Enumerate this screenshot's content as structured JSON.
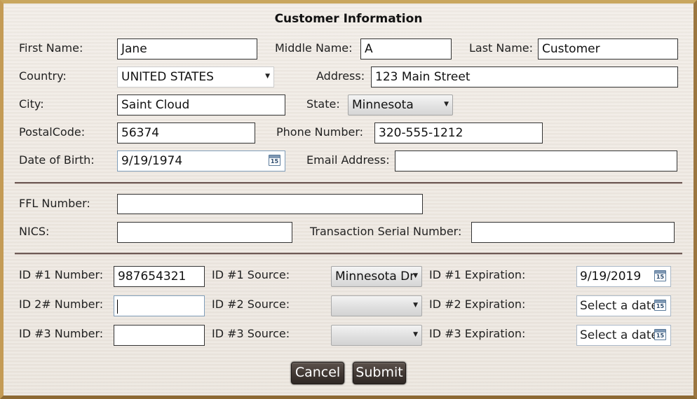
{
  "title": "Customer Information",
  "customer": {
    "first_name_label": "First Name:",
    "first_name": "Jane",
    "middle_name_label": "Middle Name:",
    "middle_name": "A",
    "last_name_label": "Last Name:",
    "last_name": "Customer",
    "country_label": "Country:",
    "country": "UNITED STATES",
    "address_label": "Address:",
    "address": "123 Main Street",
    "city_label": "City:",
    "city": "Saint Cloud",
    "state_label": "State:",
    "state": "Minnesota",
    "postal_label": "PostalCode:",
    "postal": "56374",
    "phone_label": "Phone Number:",
    "phone": "320-555-1212",
    "dob_label": "Date of Birth:",
    "dob": "9/19/1974",
    "email_label": "Email Address:",
    "email": ""
  },
  "firearm": {
    "ffl_label": "FFL Number:",
    "ffl": "",
    "nics_label": "NICS:",
    "nics": "",
    "serial_label": "Transaction Serial Number:",
    "serial": ""
  },
  "ids": [
    {
      "number_label": "ID #1 Number:",
      "number": "987654321",
      "source_label": "ID #1 Source:",
      "source": "Minnesota Dr",
      "exp_label": "ID #1 Expiration:",
      "exp": "9/19/2019"
    },
    {
      "number_label": "ID 2# Number:",
      "number": "",
      "source_label": "ID #2 Source:",
      "source": "",
      "exp_label": "ID #2 Expiration:",
      "exp": "Select a date"
    },
    {
      "number_label": "ID #3 Number:",
      "number": "",
      "source_label": "ID #3 Source:",
      "source": "",
      "exp_label": "ID #3 Expiration:",
      "exp": "Select a date"
    }
  ],
  "calendar_icon_text": "15",
  "buttons": {
    "cancel": "Cancel",
    "submit": "Submit"
  },
  "icons": {
    "dropdown": "chevron-down-icon",
    "calendar": "calendar-icon"
  },
  "colors": {
    "frame": "#b08a4a",
    "panel": "#efe9e2",
    "separator": "#6e5a56",
    "button": "#433a35"
  }
}
